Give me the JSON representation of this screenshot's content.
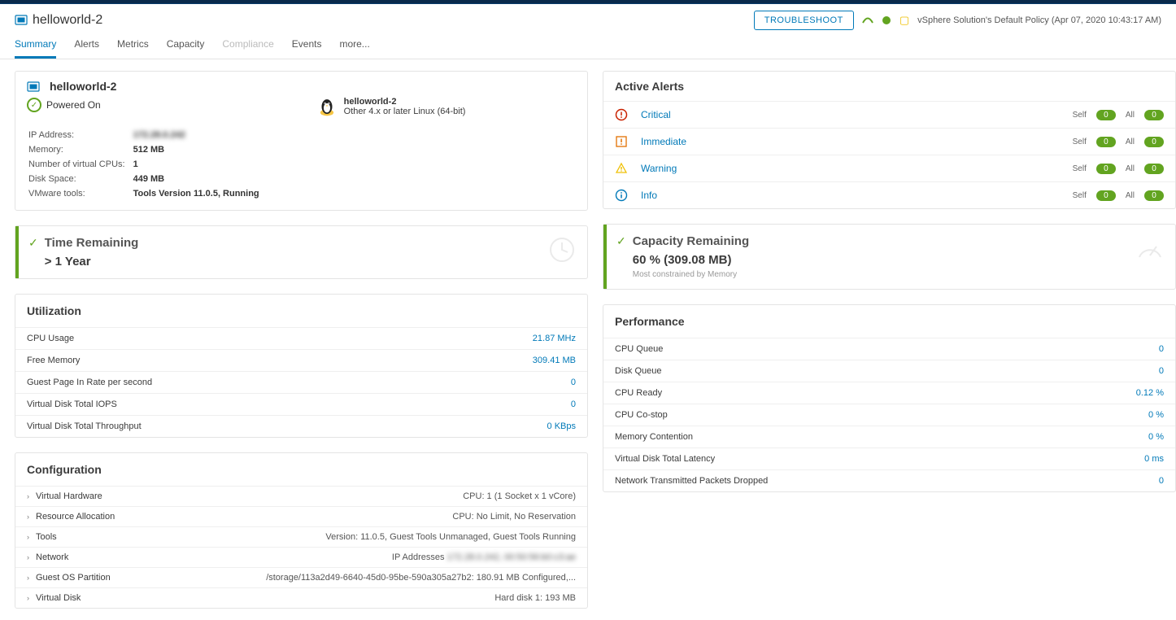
{
  "header": {
    "title": "helloworld-2",
    "troubleshoot": "TROUBLESHOOT",
    "policy_text": "vSphere Solution's Default Policy (Apr 07, 2020 10:43:17 AM)"
  },
  "tabs": [
    {
      "label": "Summary",
      "active": true
    },
    {
      "label": "Alerts"
    },
    {
      "label": "Metrics"
    },
    {
      "label": "Capacity"
    },
    {
      "label": "Compliance",
      "disabled": true
    },
    {
      "label": "Events"
    },
    {
      "label": "more..."
    }
  ],
  "summary": {
    "vm_name": "helloworld-2",
    "power_state": "Powered On",
    "os_name": "helloworld-2",
    "os_desc": "Other 4.x or later Linux (64-bit)",
    "kv": [
      {
        "k": "IP Address:",
        "v": "172.28.0.242",
        "blur": true
      },
      {
        "k": "Memory:",
        "v": "512 MB"
      },
      {
        "k": "Number of virtual CPUs:",
        "v": "1"
      },
      {
        "k": "Disk Space:",
        "v": "449 MB"
      },
      {
        "k": "VMware tools:",
        "v": "Tools Version 11.0.5, Running"
      }
    ]
  },
  "alerts": {
    "title": "Active Alerts",
    "self_label": "Self",
    "all_label": "All",
    "rows": [
      {
        "label": "Critical",
        "icon": "critical",
        "self": "0",
        "all": "0"
      },
      {
        "label": "Immediate",
        "icon": "immediate",
        "self": "0",
        "all": "0"
      },
      {
        "label": "Warning",
        "icon": "warning",
        "self": "0",
        "all": "0"
      },
      {
        "label": "Info",
        "icon": "info",
        "self": "0",
        "all": "0"
      }
    ]
  },
  "time_remaining": {
    "title": "Time Remaining",
    "value": "> 1 Year"
  },
  "capacity": {
    "title": "Capacity Remaining",
    "value": "60 % (309.08 MB)",
    "sub": "Most constrained by Memory"
  },
  "utilization": {
    "title": "Utilization",
    "rows": [
      {
        "label": "CPU Usage",
        "value": "21.87 MHz"
      },
      {
        "label": "Free Memory",
        "value": "309.41 MB"
      },
      {
        "label": "Guest Page In Rate per second",
        "value": "0"
      },
      {
        "label": "Virtual Disk Total IOPS",
        "value": "0"
      },
      {
        "label": "Virtual Disk Total Throughput",
        "value": "0 KBps"
      }
    ]
  },
  "performance": {
    "title": "Performance",
    "rows": [
      {
        "label": "CPU Queue",
        "value": "0"
      },
      {
        "label": "Disk Queue",
        "value": "0"
      },
      {
        "label": "CPU Ready",
        "value": "0.12 %"
      },
      {
        "label": "CPU Co-stop",
        "value": "0 %"
      },
      {
        "label": "Memory Contention",
        "value": "0 %"
      },
      {
        "label": "Virtual Disk Total Latency",
        "value": "0 ms"
      },
      {
        "label": "Network Transmitted Packets Dropped",
        "value": "0"
      }
    ]
  },
  "configuration": {
    "title": "Configuration",
    "rows": [
      {
        "label": "Virtual Hardware",
        "value": "CPU: 1 (1 Socket x 1 vCore)"
      },
      {
        "label": "Resource Allocation",
        "value": "CPU: No Limit, No Reservation"
      },
      {
        "label": "Tools",
        "value": "Version: 11.0.5, Guest Tools Unmanaged, Guest Tools Running"
      },
      {
        "label": "Network",
        "value": "IP Addresses  172.28.0.242,  00:50:56:b0:c3:ae",
        "blur": true,
        "prefix": "IP Addresses"
      },
      {
        "label": "Guest OS Partition",
        "value": "/storage/113a2d49-6640-45d0-95be-590a305a27b2: 180.91 MB Configured,..."
      },
      {
        "label": "Virtual Disk",
        "value": "Hard disk 1: 193 MB"
      }
    ]
  }
}
